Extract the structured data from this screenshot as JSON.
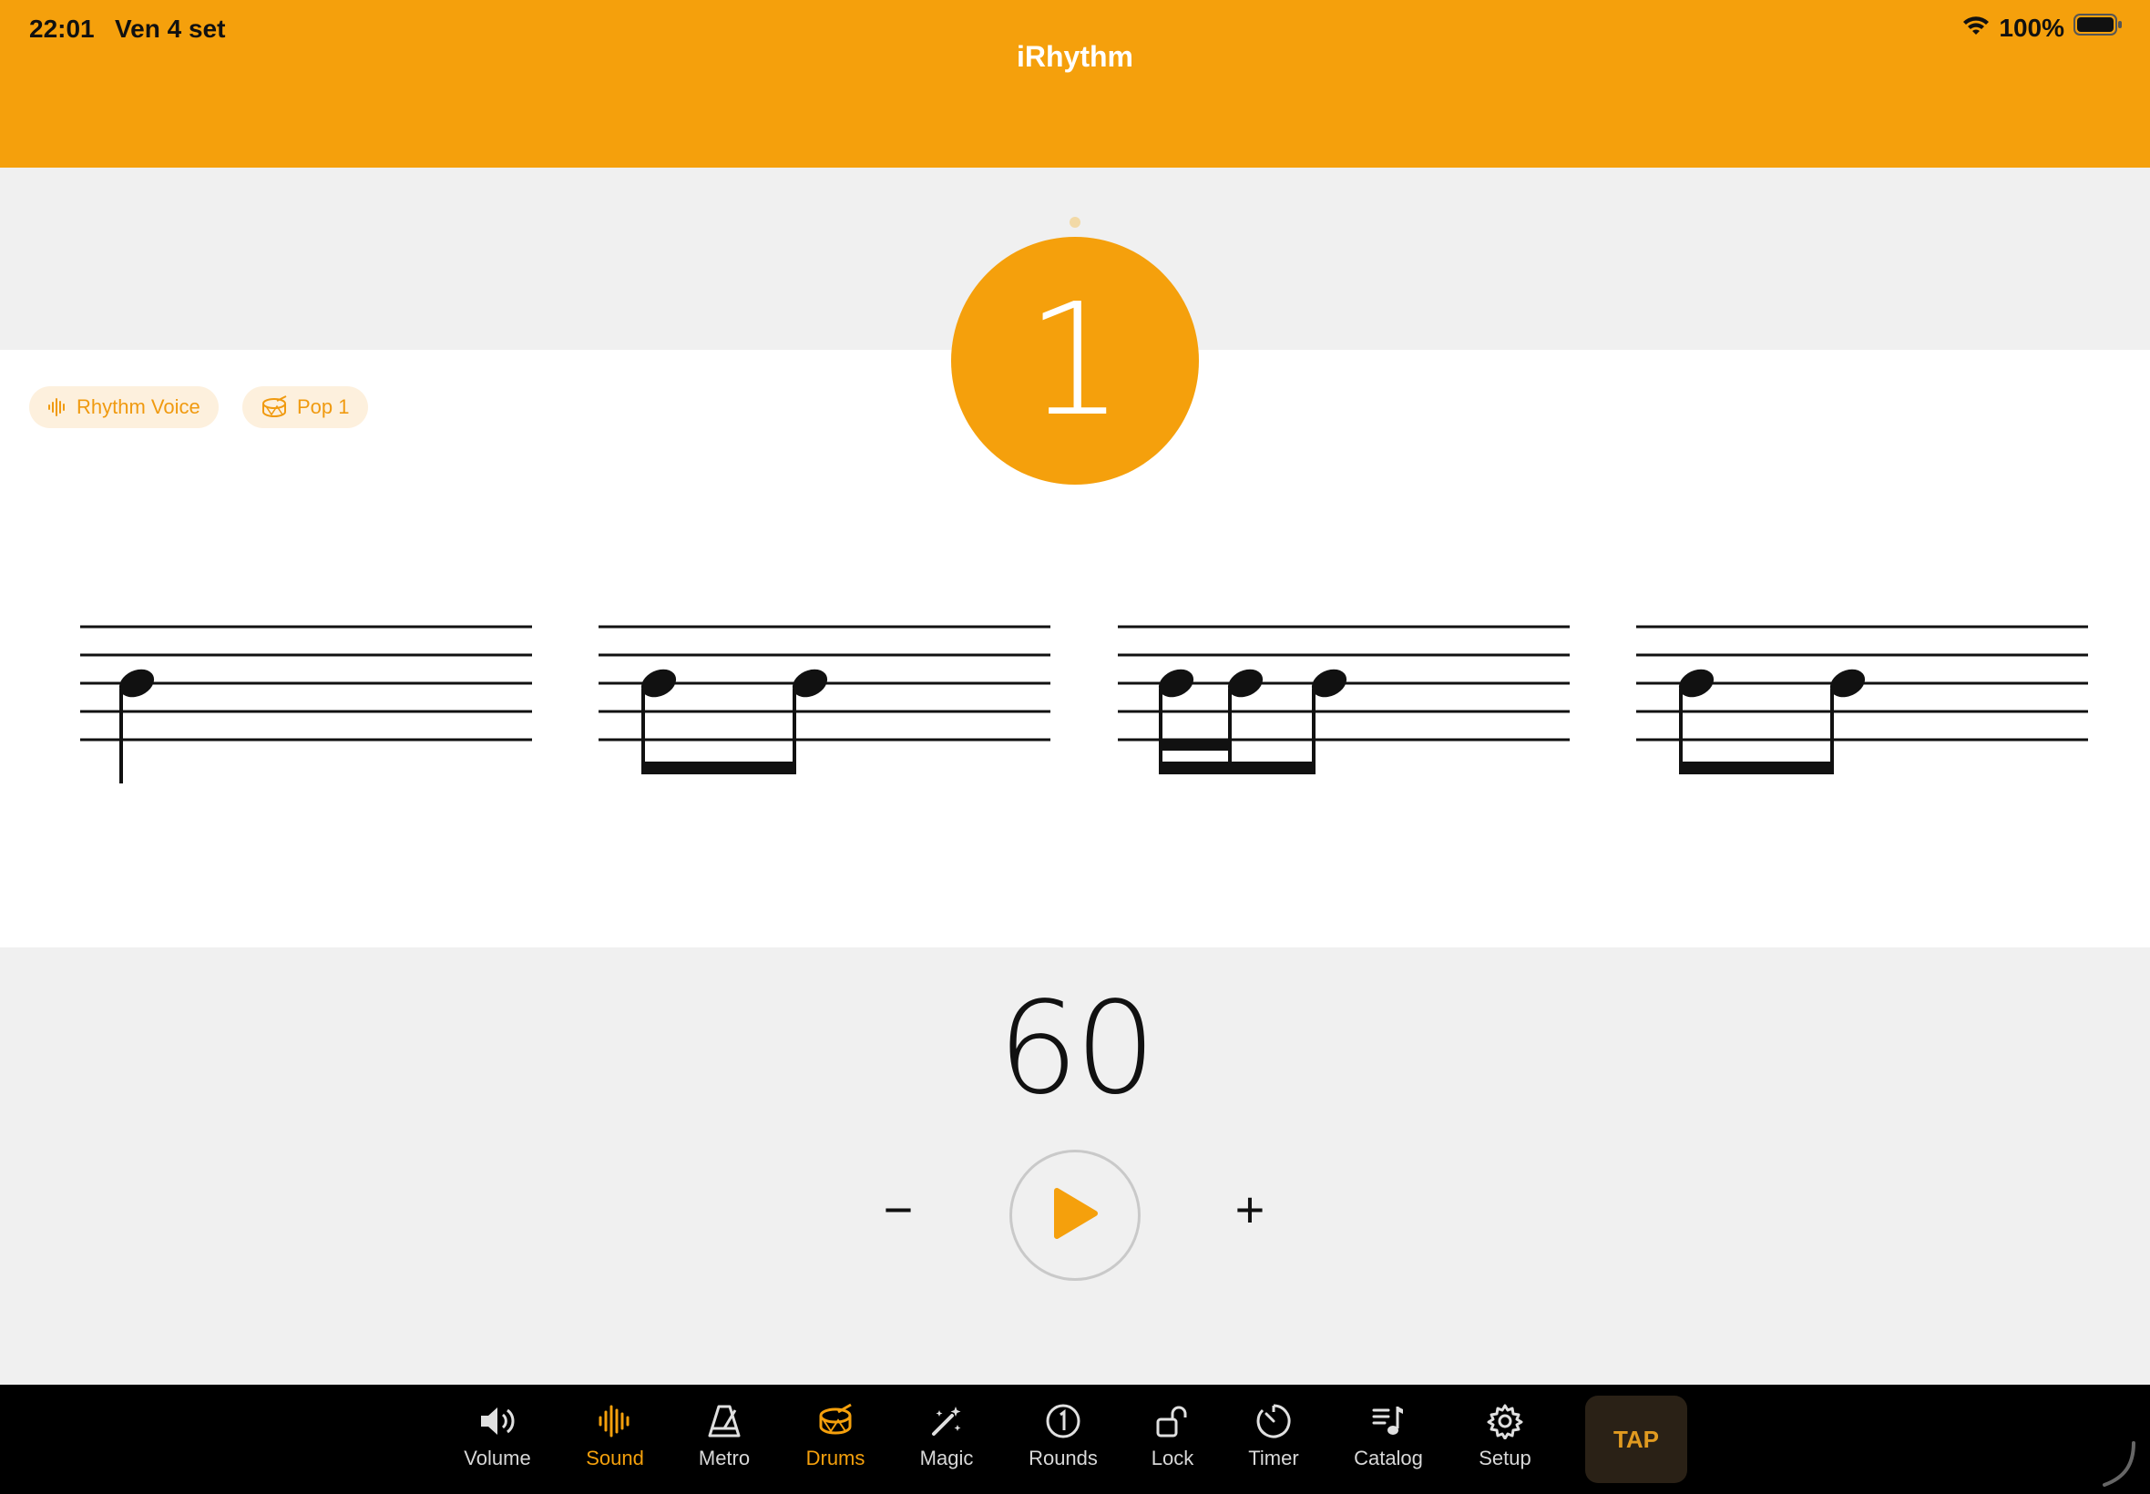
{
  "status_bar": {
    "time": "22:01",
    "date": "Ven 4 set",
    "battery": "100%"
  },
  "app": {
    "title": "iRhythm"
  },
  "beat": {
    "current": "1"
  },
  "chips": [
    {
      "label": "Rhythm Voice",
      "icon": "waveform-icon"
    },
    {
      "label": "Pop 1",
      "icon": "drum-icon"
    }
  ],
  "tempo": {
    "bpm": "60",
    "minus": "−",
    "plus": "+"
  },
  "tabs": [
    {
      "label": "Volume",
      "icon": "speaker-icon"
    },
    {
      "label": "Sound",
      "icon": "waveform-icon",
      "active": true
    },
    {
      "label": "Metro",
      "icon": "metronome-icon"
    },
    {
      "label": "Drums",
      "icon": "drum-icon",
      "active": true
    },
    {
      "label": "Magic",
      "icon": "magic-wand-icon"
    },
    {
      "label": "Rounds",
      "icon": "rounds-icon"
    },
    {
      "label": "Lock",
      "icon": "unlock-icon"
    },
    {
      "label": "Timer",
      "icon": "timer-icon"
    },
    {
      "label": "Catalog",
      "icon": "catalog-icon"
    },
    {
      "label": "Setup",
      "icon": "gear-icon"
    }
  ],
  "tap": {
    "label": "TAP"
  },
  "colors": {
    "accent": "#f5a00c",
    "chip_bg": "#fdf0dd",
    "tabbar": "#000000"
  }
}
